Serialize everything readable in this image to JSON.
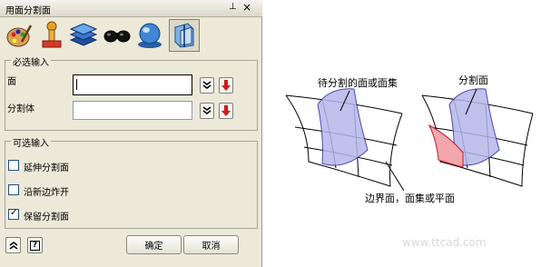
{
  "window": {
    "title": "用面分割面",
    "pin_icon": "pin-icon",
    "close_label": "×"
  },
  "toolbar": {
    "icons": [
      "palette-icon",
      "pedestal-icon",
      "layers-icon",
      "glasses-icon",
      "sphere-icon",
      "split-face-icon"
    ],
    "selected": "split-face-icon"
  },
  "required": {
    "legend": "必选输入",
    "face_label": "面",
    "face_value": "",
    "body_label": "分割体",
    "body_value": ""
  },
  "optional": {
    "legend": "可选输入",
    "options": [
      {
        "label": "延伸分割面",
        "checked": false
      },
      {
        "label": "沿新边炸开",
        "checked": false
      },
      {
        "label": "保留分割面",
        "checked": true
      }
    ]
  },
  "footer": {
    "ok_label": "确定",
    "cancel_label": "取消",
    "help_label": "?"
  },
  "diagram": {
    "label_faces": "待分割的面或面集",
    "label_split": "分割面",
    "label_boundary": "边界面，面集或平面",
    "watermark": "www.ttcad.com"
  },
  "colors": {
    "accent_red": "#cc1a1a",
    "panel_bg": "#ece9d8"
  }
}
